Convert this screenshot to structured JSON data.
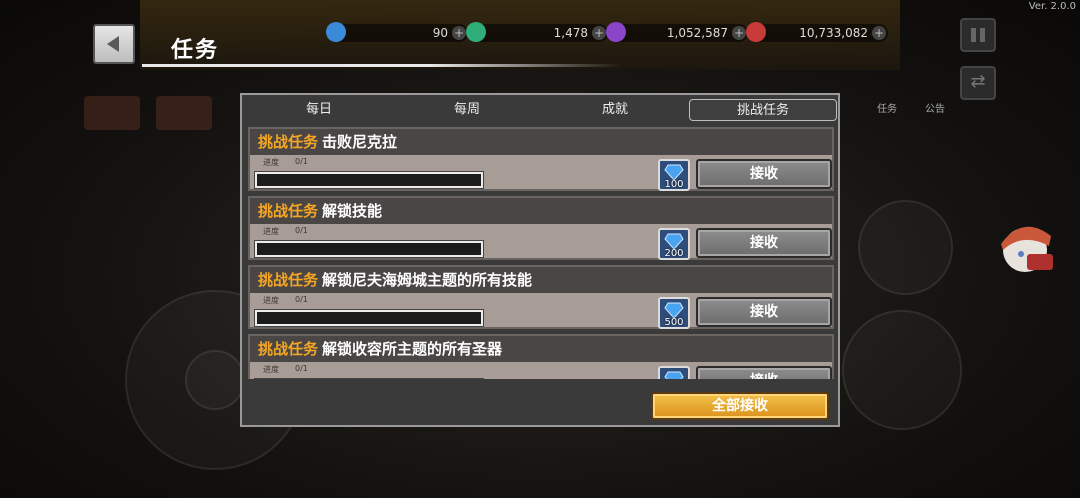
{
  "app": {
    "version": "Ver. 2.0.0"
  },
  "header": {
    "title": "任务",
    "back_icon": "back-arrow-icon"
  },
  "currencies": [
    {
      "icon": "gem-icon",
      "value": "90",
      "color": "#3a8ad8"
    },
    {
      "icon": "green-orb-icon",
      "value": "1,478",
      "color": "#2fae7a"
    },
    {
      "icon": "purple-crystal-icon",
      "value": "1,052,587",
      "color": "#8a45c9"
    },
    {
      "icon": "red-medal-icon",
      "value": "10,733,082",
      "color": "#c93a3a"
    }
  ],
  "top_menu": [
    {
      "label": "任务"
    },
    {
      "label": "公告"
    }
  ],
  "dialog": {
    "tabs": [
      {
        "label": "每日",
        "active": false
      },
      {
        "label": "每周",
        "active": false
      },
      {
        "label": "成就",
        "active": false
      },
      {
        "label": "挑战任务",
        "active": true
      }
    ],
    "tasks": [
      {
        "tag": "挑战任务",
        "name": "击败尼克拉",
        "progress_label": "进度",
        "progress": "0/1",
        "progress_fraction": 0,
        "reward_icon": "diamond-icon",
        "reward_amount": "100",
        "claim_label": "接收"
      },
      {
        "tag": "挑战任务",
        "name": "解锁技能",
        "progress_label": "进度",
        "progress": "0/1",
        "progress_fraction": 0,
        "reward_icon": "diamond-icon",
        "reward_amount": "200",
        "claim_label": "接收"
      },
      {
        "tag": "挑战任务",
        "name": "解锁尼夫海姆城主题的所有技能",
        "progress_label": "进度",
        "progress": "0/1",
        "progress_fraction": 0,
        "reward_icon": "diamond-icon",
        "reward_amount": "500",
        "claim_label": "接收"
      },
      {
        "tag": "挑战任务",
        "name": "解锁收容所主题的所有圣器",
        "progress_label": "进度",
        "progress": "0/1",
        "progress_fraction": 0,
        "reward_icon": "diamond-icon",
        "reward_amount": "",
        "claim_label": "接收"
      }
    ],
    "claim_all_label": "全部接收"
  },
  "colors": {
    "task_tag": "#f5a623",
    "claim_all": "#e6a733",
    "dialog_bg": "#3a3a3a"
  }
}
